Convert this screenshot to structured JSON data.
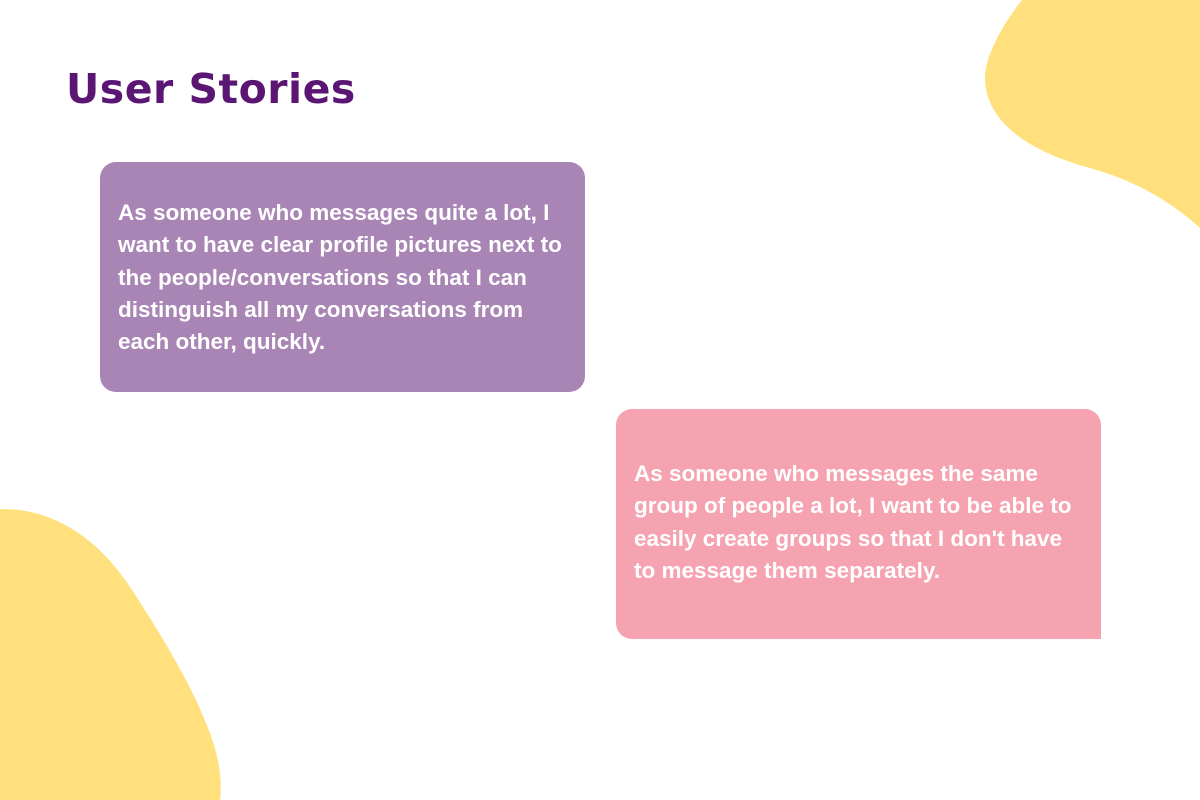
{
  "page": {
    "title": "User Stories"
  },
  "colors": {
    "background": "#ffffff",
    "title": "#5b1572",
    "blob": "#ffe07c",
    "card_purple": "#a985b6",
    "card_pink": "#f5a2b1",
    "card_text": "#ffffff"
  },
  "stories": [
    {
      "text": "As someone who messages quite a lot, I want to have clear profile pictures next to the people/conversations so that I can distinguish all my conversations from each other, quickly.",
      "color": "#a985b6"
    },
    {
      "text": "As someone who messages the same group of people a lot, I want to be able to easily create groups so that I don't have to message them separately.",
      "color": "#f5a2b1"
    }
  ]
}
